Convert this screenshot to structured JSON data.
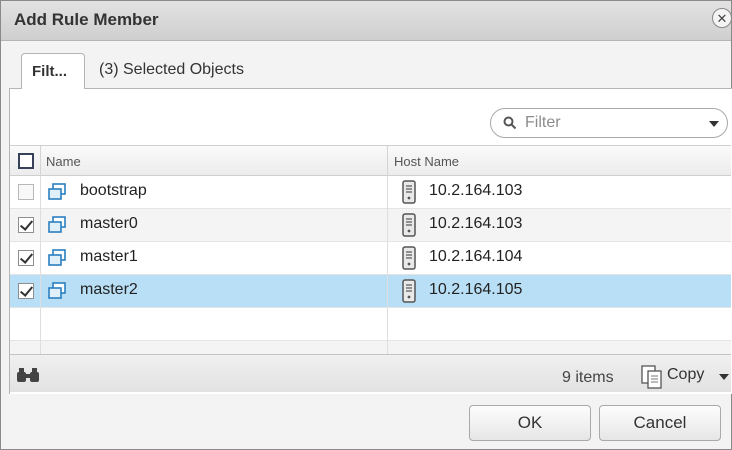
{
  "dialog": {
    "title": "Add Rule Member",
    "close_glyph": "✕"
  },
  "tabs": [
    {
      "label": "Filt...",
      "active": true
    },
    {
      "label": "(3) Selected Objects",
      "active": false
    }
  ],
  "filter": {
    "placeholder": "Filter",
    "icon": "search-icon"
  },
  "table": {
    "columns": [
      "Name",
      "Host Name"
    ],
    "rows": [
      {
        "name": "bootstrap",
        "host": "10.2.164.103",
        "checked": false
      },
      {
        "name": "master0",
        "host": "10.2.164.103",
        "checked": true
      },
      {
        "name": "master1",
        "host": "10.2.164.104",
        "checked": true
      },
      {
        "name": "master2",
        "host": "10.2.164.105",
        "checked": true,
        "selected": true
      }
    ]
  },
  "footer": {
    "count": "9 items",
    "copy_label": "Copy"
  },
  "buttons": {
    "ok": "OK",
    "cancel": "Cancel"
  },
  "colors": {
    "selected_row": "#b9dff6",
    "vm_icon": "#2a7fc0"
  }
}
